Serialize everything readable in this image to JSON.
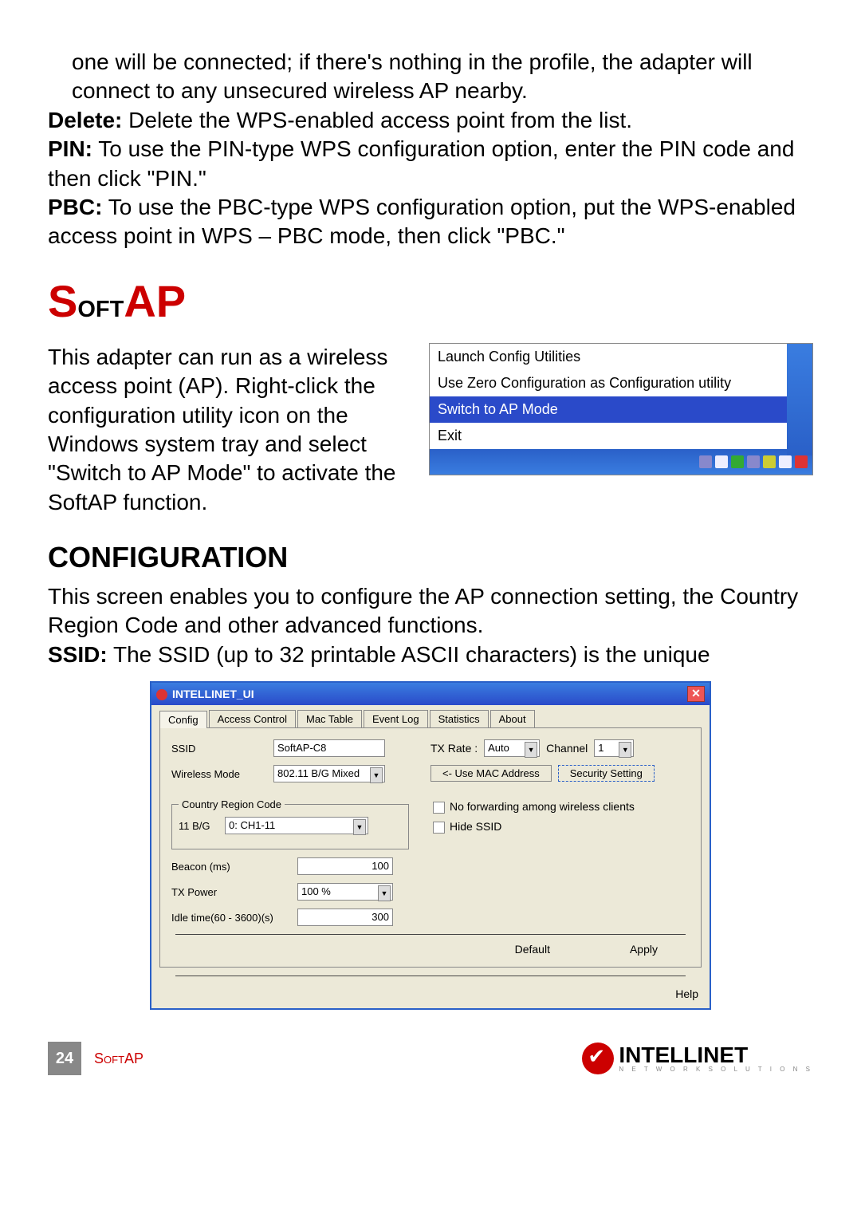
{
  "body": {
    "p1_indent": "one will be connected; if there's nothing in the profile, the adapter will connect to any unsecured wireless AP nearby.",
    "delete_label": "Delete:",
    "delete_text": " Delete the WPS-enabled access point from the list.",
    "pin_label": "PIN:",
    "pin_text": " To use the PIN-type WPS configuration option, enter the PIN code and then click \"PIN.\"",
    "pbc_label": "PBC:",
    "pbc_text": " To use the PBC-type WPS configuration option, put the WPS-enabled access point in WPS – PBC mode, then click \"PBC.\""
  },
  "section": {
    "softap_red": "S",
    "softap_rest": "oft",
    "softap_red2": "AP"
  },
  "softap_intro": "This adapter can run as a wireless access point (AP). Right-click the configuration utility icon on the Windows system tray and select \"Switch to AP Mode\" to activate the SoftAP function.",
  "context_menu": {
    "items": [
      "Launch Config Utilities",
      "Use Zero Configuration as Configuration utility",
      "Switch to AP Mode",
      "Exit"
    ]
  },
  "config_heading": "CONFIGURATION",
  "config_intro": "This screen enables you to configure the AP connection setting, the Country Region Code and other advanced functions.",
  "ssid_label": "SSID:",
  "ssid_text": " The SSID (up to 32 printable ASCII characters) is the unique",
  "dialog": {
    "title": "INTELLINET_UI",
    "tabs": [
      "Config",
      "Access Control",
      "Mac Table",
      "Event Log",
      "Statistics",
      "About"
    ],
    "ssid_lbl": "SSID",
    "ssid_val": "SoftAP-C8",
    "txrate_lbl": "TX Rate :",
    "txrate_val": "Auto",
    "channel_lbl": "Channel",
    "channel_val": "1",
    "wmode_lbl": "Wireless Mode",
    "wmode_val": "802.11 B/G Mixed",
    "usemac_btn": "<- Use MAC Address",
    "sec_btn": "Security Setting",
    "crc_legend": "Country Region Code",
    "crc_lbl": "11 B/G",
    "crc_val": "0: CH1-11",
    "nofwd": "No forwarding among wireless clients",
    "hidessid": "Hide SSID",
    "beacon_lbl": "Beacon (ms)",
    "beacon_val": "100",
    "txpower_lbl": "TX Power",
    "txpower_val": "100 %",
    "idle_lbl": "Idle time(60 - 3600)(s)",
    "idle_val": "300",
    "default_btn": "Default",
    "apply_btn": "Apply",
    "help_btn": "Help"
  },
  "footer": {
    "page": "24",
    "label": "SoftAP",
    "brand": "INTELLINET",
    "tagline": "N E T W O R K   S O L U T I O N S"
  }
}
